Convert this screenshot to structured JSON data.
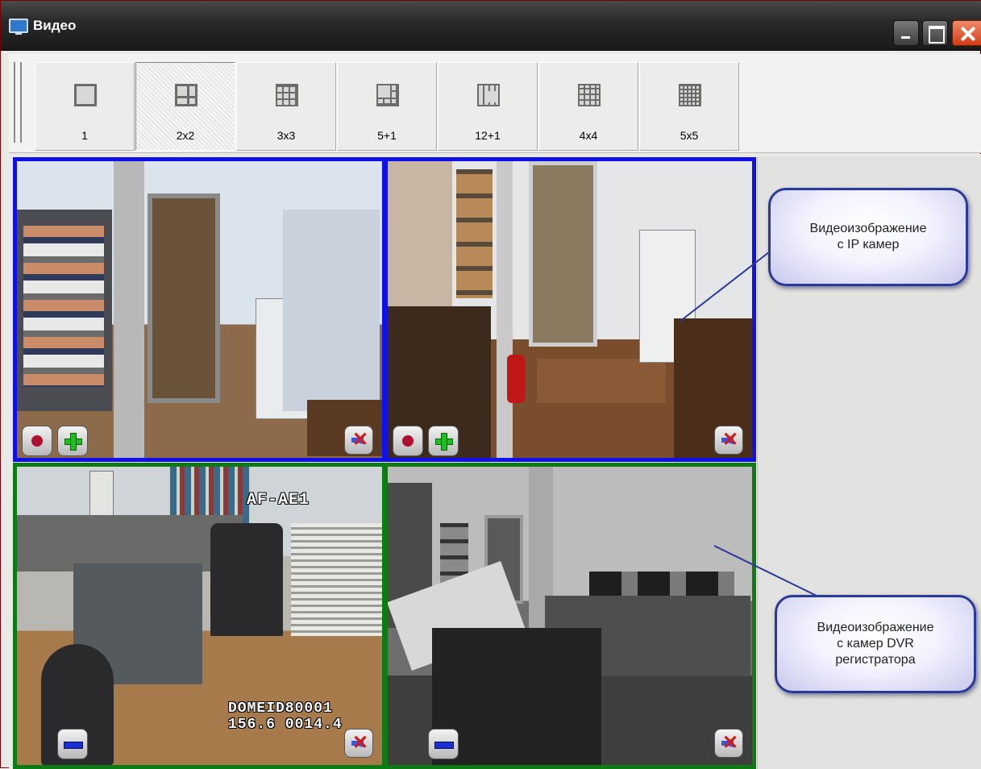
{
  "window": {
    "title": "Видео"
  },
  "toolbar": {
    "layouts": [
      {
        "label": "1",
        "icon": "single-grid-icon",
        "active": false
      },
      {
        "label": "2x2",
        "icon": "grid-2x2-icon",
        "active": true
      },
      {
        "label": "3x3",
        "icon": "grid-3x3-icon",
        "active": false
      },
      {
        "label": "5+1",
        "icon": "grid-5plus1-icon",
        "active": false
      },
      {
        "label": "12+1",
        "icon": "grid-12plus1-icon",
        "active": false
      },
      {
        "label": "4x4",
        "icon": "grid-4x4-icon",
        "active": false
      },
      {
        "label": "5x5",
        "icon": "grid-5x5-icon",
        "active": false
      }
    ]
  },
  "cameras": [
    {
      "source": "ip",
      "border_color": "#1010e8",
      "controls": [
        "record-button",
        "add-button",
        "mute-button"
      ]
    },
    {
      "source": "ip",
      "border_color": "#1010e8",
      "controls": [
        "record-button",
        "add-button",
        "mute-button"
      ]
    },
    {
      "source": "dvr",
      "border_color": "#0d7a14",
      "osd_top": "AF-AE1",
      "osd_bottom_1": "DOMEID80001",
      "osd_bottom_2": "156.6 0014.4",
      "controls": [
        "remove-button",
        "mute-button"
      ]
    },
    {
      "source": "dvr",
      "border_color": "#0d7a14",
      "controls": [
        "remove-button",
        "mute-button"
      ]
    }
  ],
  "callouts": {
    "ip": {
      "line1": "Видеоизображение",
      "line2": "с IP камер"
    },
    "dvr": {
      "line1": "Видеоизображение",
      "line2": "с камер DVR",
      "line3": "регистратора"
    }
  },
  "colors": {
    "ip_border": "#1010e8",
    "dvr_border": "#0d7a14",
    "callout_border": "#2a3a9a",
    "close_button": "#d23d14"
  }
}
